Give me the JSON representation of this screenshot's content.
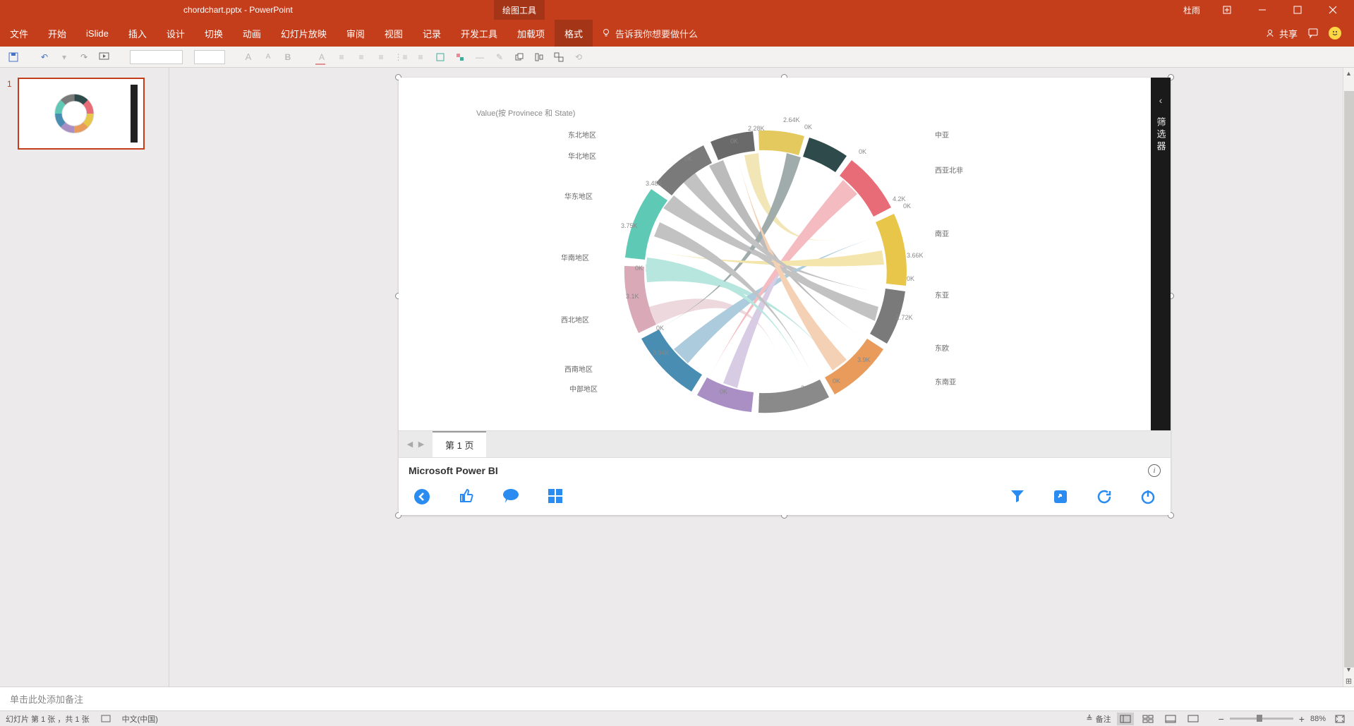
{
  "titlebar": {
    "filename": "chordchart.pptx",
    "appname": "PowerPoint",
    "contextual_tab": "绘图工具",
    "username": "杜雨"
  },
  "ribbon": {
    "tabs": [
      "文件",
      "开始",
      "iSlide",
      "插入",
      "设计",
      "切换",
      "动画",
      "幻灯片放映",
      "审阅",
      "视图",
      "记录",
      "开发工具",
      "加载项",
      "格式"
    ],
    "active_tab": "格式",
    "tell_me": "告诉我你想要做什么",
    "share": "共享"
  },
  "slide_panel": {
    "slides": [
      {
        "num": "1"
      }
    ]
  },
  "powerbi": {
    "chart_title": "Value(按 Provinece 和 State)",
    "filter_label": "筛选器",
    "page_tab": "第 1 页",
    "brand": "Microsoft Power BI"
  },
  "chart_data": {
    "type": "chord",
    "title": "Value(按 Provinece 和 State)",
    "left_categories": [
      "东北地区",
      "华北地区",
      "华东地区",
      "华南地区",
      "西北地区",
      "西南地区",
      "中部地区"
    ],
    "right_categories": [
      "中亚",
      "西亚北非",
      "南亚",
      "东亚",
      "东欧",
      "东南亚"
    ],
    "arc_values_visible": [
      "2.64K",
      "2.28K",
      "3.48K",
      "3.75K",
      "3.1K",
      "3.94K",
      "2.59K",
      "3.05K",
      "3.9K",
      "2.72K",
      "3.66K",
      "4.2K"
    ],
    "zero_ticks": [
      "0K",
      "0K",
      "0K",
      "0K",
      "0K",
      "0K",
      "0K",
      "0K",
      "0K",
      "0K",
      "0K",
      "0K",
      "0K"
    ],
    "colors": {
      "东北地区": "#e3c95e",
      "华北地区": "#6a6a6a",
      "华东地区": "#7a7a7a",
      "华南地区": "#5ec9b5",
      "西北地区": "#d9a9b8",
      "西南地区": "#4a8db3",
      "中部地区": "#a98fc4",
      "中亚": "#2f4a4a",
      "西亚北非": "#e86b78",
      "南亚": "#e8c64a",
      "东亚": "#7a7a7a",
      "东欧": "#e89b5a",
      "东南亚": "#8a8a8a"
    }
  },
  "notes": {
    "placeholder": "单击此处添加备注"
  },
  "statusbar": {
    "slide_info": "幻灯片 第 1 张 ，共 1 张",
    "language": "中文(中国)",
    "notes_btn": "备注",
    "zoom": "88%"
  }
}
